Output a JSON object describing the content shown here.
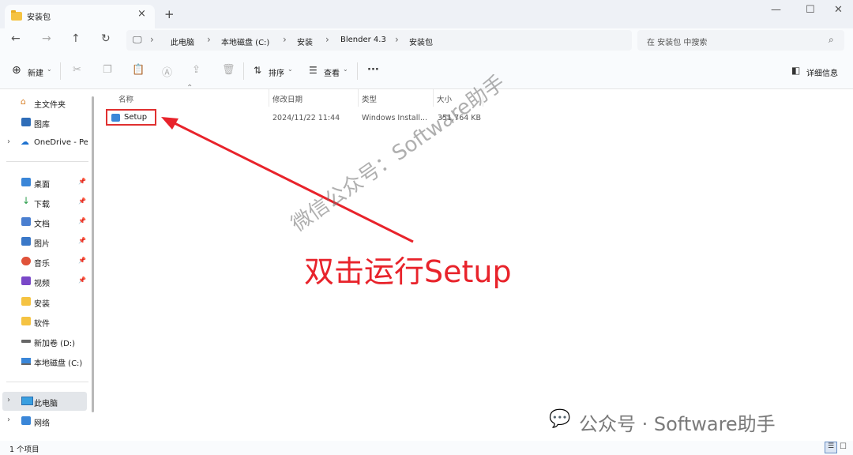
{
  "window": {
    "tab_title": "安装包",
    "tab_close": "×",
    "new_tab": "+",
    "minimize": "—",
    "maximize": "☐",
    "close": "✕"
  },
  "nav": {
    "back": "←",
    "forward": "→",
    "up": "↑",
    "refresh": "↻",
    "breadcrumb": [
      "此电脑",
      "本地磁盘 (C:)",
      "安装",
      "Blender 4.3",
      "安装包"
    ],
    "search_placeholder": "在 安装包 中搜索"
  },
  "toolbar": {
    "new_label": "新建",
    "sort_label": "排序",
    "view_label": "查看",
    "more": "···",
    "details_pane": "详细信息"
  },
  "sidebar": {
    "home": "主文件夹",
    "gallery": "图库",
    "onedrive": "OneDrive - Per",
    "quick": [
      {
        "label": "桌面",
        "icon": "desktop-icon",
        "color": "#3a86d8"
      },
      {
        "label": "下载",
        "icon": "download-icon",
        "color": "#2a9d4a"
      },
      {
        "label": "文档",
        "icon": "document-icon",
        "color": "#4a7fd0"
      },
      {
        "label": "图片",
        "icon": "pictures-icon",
        "color": "#3a78c8"
      },
      {
        "label": "音乐",
        "icon": "music-icon",
        "color": "#e0533a"
      },
      {
        "label": "视频",
        "icon": "video-icon",
        "color": "#7a48c8"
      },
      {
        "label": "安装",
        "icon": "folder-icon",
        "color": "#f5c342"
      },
      {
        "label": "软件",
        "icon": "folder-icon",
        "color": "#f5c342"
      },
      {
        "label": "新加卷 (D:)",
        "icon": "drive-icon",
        "color": "#666666"
      },
      {
        "label": "本地磁盘 (C:)",
        "icon": "drive-icon",
        "color": "#3a86d8"
      }
    ],
    "this_pc": "此电脑",
    "network": "网络"
  },
  "columns": {
    "name": "名称",
    "date": "修改日期",
    "type": "类型",
    "size": "大小"
  },
  "files": [
    {
      "name": "Setup",
      "date": "2024/11/22 11:44",
      "type": "Windows Install...",
      "size": "351,764 KB"
    }
  ],
  "annotation": {
    "instruction": "双击运行Setup",
    "watermark_diagonal": "微信公众号：Software助手",
    "watermark_bottom": "公众号 · Software助手",
    "arrow_color": "#e8232b"
  },
  "status": {
    "item_count": "1 个项目"
  }
}
